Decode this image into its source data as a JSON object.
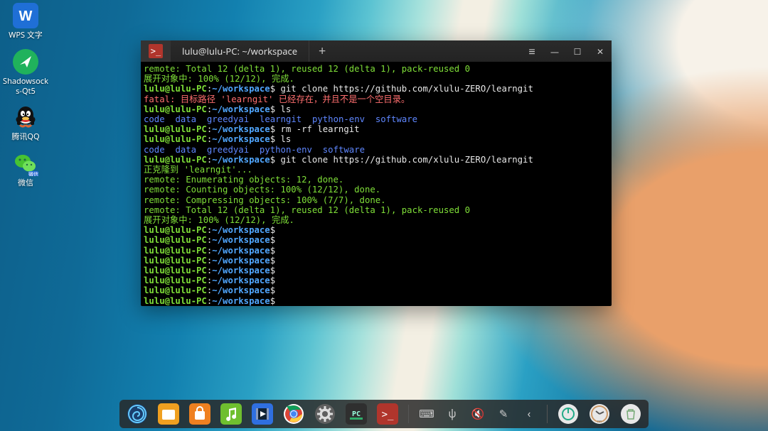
{
  "desktop_icons": [
    {
      "name": "wps",
      "label": "WPS 文字",
      "bg": "#1f6fd6",
      "glyph": "W"
    },
    {
      "name": "shadowsocks",
      "label": "Shadowsock\ns-Qt5",
      "bg": "#20b25c",
      "glyph": "send"
    },
    {
      "name": "tencent-qq",
      "label": "腾讯QQ",
      "bg": "transparent",
      "glyph": "qq"
    },
    {
      "name": "wechat",
      "label": "微信",
      "bg": "transparent",
      "glyph": "wechat"
    }
  ],
  "terminal": {
    "tab_title": "lulu@lulu-PC: ~/workspace",
    "newtab_glyph": "+",
    "controls": {
      "menu": "≡",
      "min": "—",
      "max": "☐",
      "close": "✕"
    },
    "prompt": {
      "userhost": "lulu@lulu-PC",
      "sep": ":",
      "cwd": "~/workspace",
      "sigil": "$"
    },
    "lines": [
      {
        "t": "out",
        "cls": "g",
        "text": "remote: Total 12 (delta 1), reused 12 (delta 1), pack-reused 0"
      },
      {
        "t": "out",
        "cls": "g",
        "text": "展开对象中: 100% (12/12), 完成."
      },
      {
        "t": "cmd",
        "cmd": " git clone https://github.com/xlulu-ZERO/learngit"
      },
      {
        "t": "out",
        "cls": "r",
        "text": "fatal: 目标路径 'learngit' 已经存在，并且不是一个空目录。"
      },
      {
        "t": "cmd",
        "cmd": " ls"
      },
      {
        "t": "ls",
        "items": [
          "code",
          "data",
          "greedyai",
          "learngit",
          "python-env",
          "software"
        ]
      },
      {
        "t": "cmd",
        "cmd": " rm -rf learngit"
      },
      {
        "t": "cmd",
        "cmd": " ls"
      },
      {
        "t": "ls",
        "items": [
          "code",
          "data",
          "greedyai",
          "python-env",
          "software"
        ]
      },
      {
        "t": "cmd",
        "cmd": " git clone https://github.com/xlulu-ZERO/learngit"
      },
      {
        "t": "out",
        "cls": "g",
        "text": "正克隆到 'learngit'..."
      },
      {
        "t": "out",
        "cls": "g",
        "text": "remote: Enumerating objects: 12, done."
      },
      {
        "t": "out",
        "cls": "g",
        "text": "remote: Counting objects: 100% (12/12), done."
      },
      {
        "t": "out",
        "cls": "g",
        "text": "remote: Compressing objects: 100% (7/7), done."
      },
      {
        "t": "out",
        "cls": "g",
        "text": "remote: Total 12 (delta 1), reused 12 (delta 1), pack-reused 0"
      },
      {
        "t": "out",
        "cls": "g",
        "text": "展开对象中: 100% (12/12), 完成."
      },
      {
        "t": "cmd",
        "cmd": ""
      },
      {
        "t": "cmd",
        "cmd": ""
      },
      {
        "t": "cmd",
        "cmd": ""
      },
      {
        "t": "cmd",
        "cmd": ""
      },
      {
        "t": "cmd",
        "cmd": ""
      },
      {
        "t": "cmd",
        "cmd": ""
      },
      {
        "t": "cmd",
        "cmd": ""
      },
      {
        "t": "cmd",
        "cmd": ""
      }
    ]
  },
  "dock": {
    "apps": [
      {
        "name": "launcher",
        "bg": "#1a3f6e",
        "glyph": "deepin"
      },
      {
        "name": "file-manager",
        "bg": "#f0a020",
        "glyph": "folder"
      },
      {
        "name": "app-store",
        "bg": "#ef8020",
        "glyph": "bag"
      },
      {
        "name": "music",
        "bg": "#6fbf2f",
        "glyph": "note"
      },
      {
        "name": "video",
        "bg": "#2f6fe0",
        "glyph": "film"
      },
      {
        "name": "chrome",
        "bg": "#ffffff",
        "glyph": "chrome"
      },
      {
        "name": "settings",
        "bg": "#5f5f5f",
        "glyph": "gear"
      },
      {
        "name": "pycharm",
        "bg": "#2f2f2f",
        "glyph": "PC"
      },
      {
        "name": "terminal",
        "bg": "#b0352c",
        "glyph": ">_"
      }
    ],
    "tray": [
      {
        "name": "keyboard-icon",
        "glyph": "⌨"
      },
      {
        "name": "usb-icon",
        "glyph": "ψ"
      },
      {
        "name": "volume-icon",
        "glyph": "🔇"
      },
      {
        "name": "theme-icon",
        "glyph": "✎"
      },
      {
        "name": "tray-collapse-icon",
        "glyph": "‹"
      }
    ],
    "right": [
      {
        "name": "shutdown-button",
        "bg": "#e8e8e8",
        "glyph": "⏻"
      },
      {
        "name": "clock-widget",
        "bg": "#e8e8e8",
        "glyph": "10:10"
      },
      {
        "name": "trash-button",
        "bg": "#e8e8e8",
        "glyph": "🗑"
      }
    ]
  }
}
